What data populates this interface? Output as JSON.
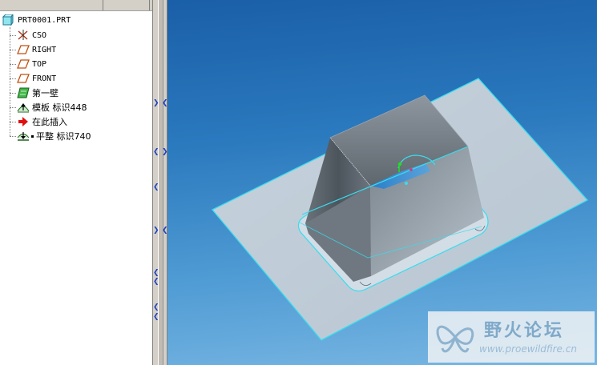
{
  "model_tree": {
    "root": {
      "label": "PRT0001.PRT",
      "icon": "part-icon"
    },
    "items": [
      {
        "label": "CSO",
        "icon": "coordinate-system-icon"
      },
      {
        "label": "RIGHT",
        "icon": "datum-plane-icon"
      },
      {
        "label": "TOP",
        "icon": "datum-plane-icon"
      },
      {
        "label": "FRONT",
        "icon": "datum-plane-icon"
      },
      {
        "label": "第一壁",
        "icon": "first-wall-icon"
      },
      {
        "label": "模板 标识448",
        "icon": "form-icon"
      },
      {
        "label": "在此插入",
        "icon": "insert-here-arrow-icon"
      },
      {
        "label": "平整 标识740",
        "icon": "flatten-icon"
      }
    ]
  },
  "colors": {
    "viewport_top": "#1a5fa8",
    "viewport_bottom": "#78b6e2",
    "sheet_fill": "#c4d1dc",
    "edge_highlight": "#35e0f0",
    "box_dark": "#505860",
    "box_light": "#b8c4cc"
  },
  "watermark": {
    "title": "野火论坛",
    "url": "www.proewildfire.cn"
  }
}
